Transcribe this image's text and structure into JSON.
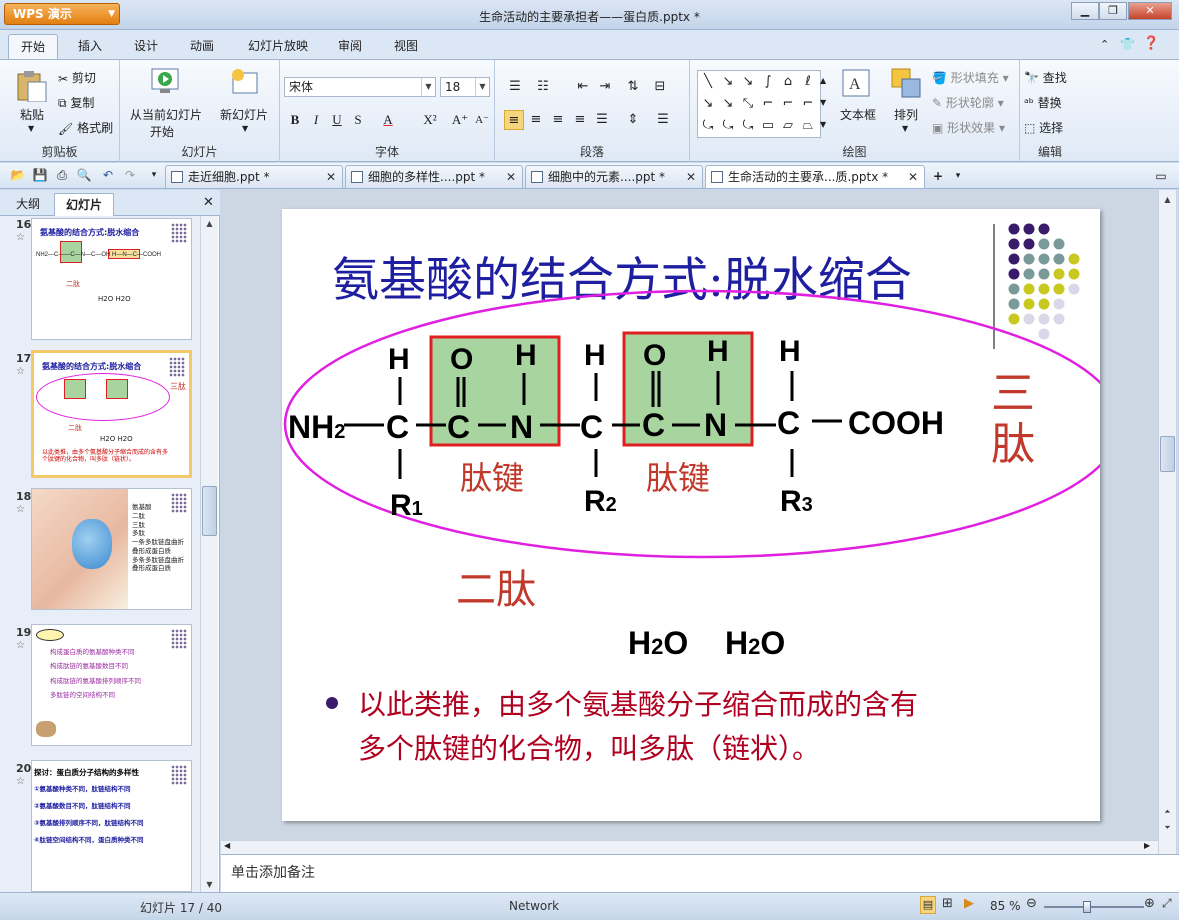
{
  "app": {
    "name": "WPS 演示",
    "window_title": "生命活动的主要承担者——蛋白质.pptx *"
  },
  "ribbon_tabs": [
    "开始",
    "插入",
    "设计",
    "动画",
    "幻灯片放映",
    "审阅",
    "视图"
  ],
  "ribbon": {
    "clipboard": {
      "paste": "粘贴",
      "cut": "剪切",
      "copy": "复制",
      "format_painter": "格式刷",
      "label": "剪贴板"
    },
    "slides": {
      "from_current": "从当前幻灯片",
      "start": "开始",
      "new_slide": "新幻灯片",
      "label": "幻灯片"
    },
    "font": {
      "name": "宋体",
      "size": "18",
      "label": "字体"
    },
    "paragraph": {
      "label": "段落"
    },
    "drawing": {
      "text_box": "文本框",
      "arrange": "排列",
      "shape_fill": "形状填充",
      "shape_outline": "形状轮廓",
      "shape_effect": "形状效果",
      "label": "绘图"
    },
    "editing": {
      "find": "查找",
      "replace": "替换",
      "select": "选择",
      "label": "编辑"
    }
  },
  "doc_tabs": [
    {
      "label": "走近细胞.ppt *",
      "active": false
    },
    {
      "label": "细胞的多样性....ppt *",
      "active": false
    },
    {
      "label": "细胞中的元素....ppt *",
      "active": false
    },
    {
      "label": "生命活动的主要承...质.pptx *",
      "active": true
    }
  ],
  "left_pane": {
    "tabs": [
      "大纲",
      "幻灯片"
    ],
    "thumbs": [
      {
        "num": "16",
        "title": "氨基酸的结合方式:脱水缩合",
        "sub": "二肽",
        "water": "H2O  H2O"
      },
      {
        "num": "17",
        "title": "氨基酸的结合方式:脱水缩合",
        "sub": "二肽",
        "water": "H2O  H2O",
        "side": "三肽",
        "bullet": "以此类推，由多个氨基酸分子缩合而成的含有多个肽键的化合物，叫多肽（链状）。"
      },
      {
        "num": "18",
        "labels": [
          "氨基酸",
          "二肽",
          "三肽",
          "多肽",
          "一条多肽链盘曲折",
          "叠形成蛋白质",
          "多条多肽链盘曲折",
          "叠形成蛋白质"
        ]
      },
      {
        "num": "19",
        "lines": [
          "构成蛋白质的氨基酸种类不同",
          "构成肽链的氨基酸数目不同",
          "构成肽链的氨基酸排列顺序不同",
          "多肽链的空间结构不同"
        ]
      },
      {
        "num": "20",
        "title": "探讨：蛋白质分子结构的多样性",
        "lines": [
          "①氨基酸种类不同，肽链结构不同",
          "②氨基酸数目不同，肽链结构不同",
          "③氨基酸排列顺序不同，肽链结构不同",
          "④肽链空间结构不同，蛋白质种类不同"
        ]
      }
    ]
  },
  "slide": {
    "title": "氨基酸的结合方式:脱水缩合",
    "chem": {
      "nh2": "NH",
      "sub2": "2",
      "h": "H",
      "c": "C",
      "o": "O",
      "n": "N",
      "cooh": "COOH",
      "r": "R",
      "r1": "1",
      "r2": "2",
      "r3": "3"
    },
    "peptide_bond": "肽键",
    "tripeptide": "三肽",
    "dipeptide": "二肽",
    "water": "H",
    "water_sub": "2",
    "water_o": "O",
    "bullet": "以此类推，由多个氨基酸分子缩合而成的含有多个肽键的化合物，叫多肽（链状）。",
    "bullet_line1": "以此类推，由多个氨基酸分子缩合而成的含有",
    "bullet_line2": "多个肽键的化合物，叫多肽（链状）。"
  },
  "notes_placeholder": "单击添加备注",
  "status": {
    "slide_indicator": "幻灯片 17 / 40",
    "network": "Network",
    "zoom": "85 %"
  },
  "colors": {
    "title_blue": "#1e1ea0",
    "accent_red": "#c0392b",
    "ellipse": "#e020e0",
    "bond_box": "#a8d4a0",
    "bond_border": "#e02020"
  }
}
